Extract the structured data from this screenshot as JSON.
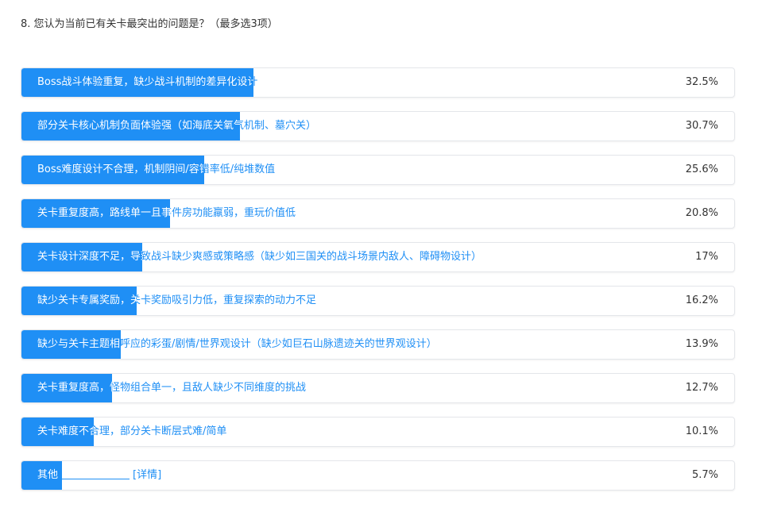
{
  "question": "8. 您认为当前已有关卡最突出的问题是？（最多选3项）",
  "options": [
    {
      "label": "Boss战斗体验重复，缺少战斗机制的差异化设计",
      "percent": 32.5,
      "percent_text": "32.5%"
    },
    {
      "label": "部分关卡核心机制负面体验强（如海底关氧气机制、墓穴关）",
      "percent": 30.7,
      "percent_text": "30.7%"
    },
    {
      "label": "Boss难度设计不合理，机制阴间/容错率低/纯堆数值",
      "percent": 25.6,
      "percent_text": "25.6%"
    },
    {
      "label": "关卡重复度高，路线单一且事件房功能羸弱，重玩价值低",
      "percent": 20.8,
      "percent_text": "20.8%"
    },
    {
      "label": "关卡设计深度不足，导致战斗缺少爽感或策略感（缺少如三国关的战斗场景内敌人、障碍物设计）",
      "percent": 17,
      "percent_text": "17%"
    },
    {
      "label": "缺少关卡专属奖励，关卡奖励吸引力低，重复探索的动力不足",
      "percent": 16.2,
      "percent_text": "16.2%"
    },
    {
      "label": "缺少与关卡主题相呼应的彩蛋/剧情/世界观设计（缺少如巨石山脉遗迹关的世界观设计）",
      "percent": 13.9,
      "percent_text": "13.9%"
    },
    {
      "label": "关卡重复度高，怪物组合单一，且敌人缺少不同维度的挑战",
      "percent": 12.7,
      "percent_text": "12.7%"
    },
    {
      "label": "关卡难度不合理，部分关卡断层式难/简单",
      "percent": 10.1,
      "percent_text": "10.1%"
    },
    {
      "label": "其他",
      "percent": 5.7,
      "percent_text": "5.7%",
      "detail": "[详情]"
    }
  ],
  "colors": {
    "accent": "#1f8ff5",
    "text": "#333333",
    "border": "#e4e6ea"
  }
}
